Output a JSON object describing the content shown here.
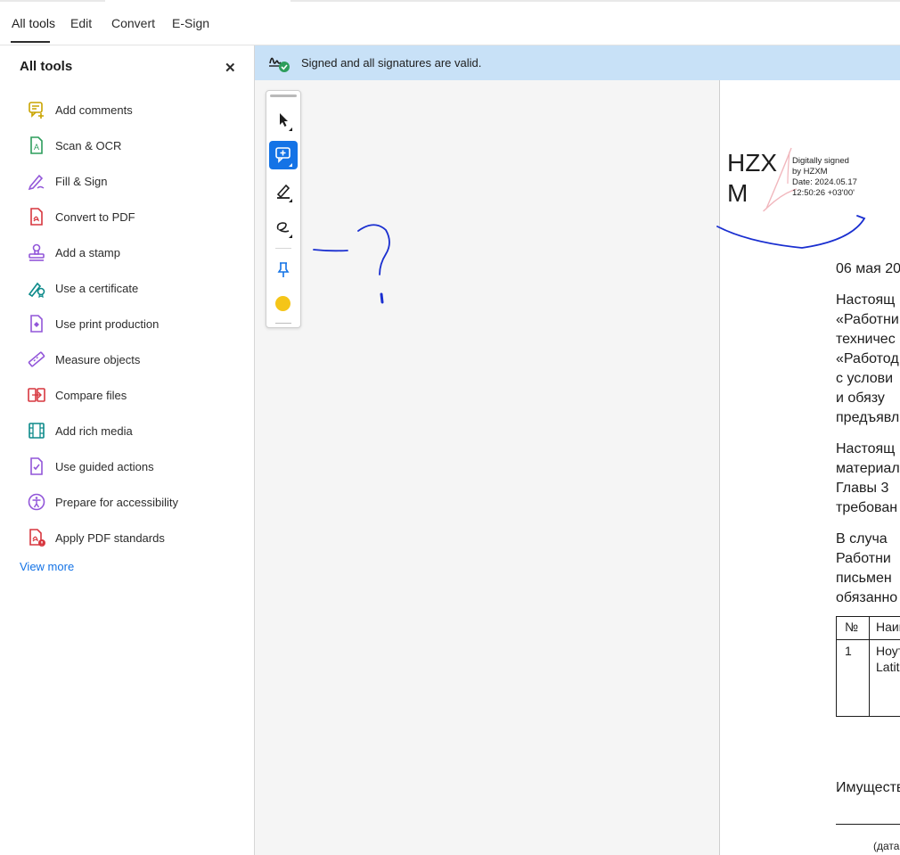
{
  "tabs": [
    {
      "label": "All tools"
    },
    {
      "label": "Edit"
    },
    {
      "label": "Convert"
    },
    {
      "label": "E-Sign"
    }
  ],
  "panel": {
    "title": "All tools",
    "close_glyph": "✕",
    "items": [
      {
        "label": "Add comments",
        "icon": "add-comments-icon",
        "color": "#c9a400"
      },
      {
        "label": "Scan & OCR",
        "icon": "scan-ocr-icon",
        "color": "#2d9d5c"
      },
      {
        "label": "Fill & Sign",
        "icon": "fill-sign-icon",
        "color": "#9256d9"
      },
      {
        "label": "Convert to PDF",
        "icon": "convert-pdf-icon",
        "color": "#d7373f"
      },
      {
        "label": "Add a stamp",
        "icon": "stamp-icon",
        "color": "#9256d9"
      },
      {
        "label": "Use a certificate",
        "icon": "certificate-icon",
        "color": "#0d8a8a"
      },
      {
        "label": "Use print production",
        "icon": "print-production-icon",
        "color": "#9256d9"
      },
      {
        "label": "Measure objects",
        "icon": "measure-icon",
        "color": "#9256d9"
      },
      {
        "label": "Compare files",
        "icon": "compare-icon",
        "color": "#d7373f"
      },
      {
        "label": "Add rich media",
        "icon": "rich-media-icon",
        "color": "#0d8a8a"
      },
      {
        "label": "Use guided actions",
        "icon": "guided-actions-icon",
        "color": "#9256d9"
      },
      {
        "label": "Prepare for accessibility",
        "icon": "accessibility-icon",
        "color": "#9256d9"
      },
      {
        "label": "Apply PDF standards",
        "icon": "pdf-standards-icon",
        "color": "#d7373f"
      }
    ],
    "view_more": "View more"
  },
  "notification": {
    "text": "Signed and all signatures are valid.",
    "icon": "signature-valid-icon"
  },
  "toolbar": {
    "tools": [
      "select-icon",
      "add-comment-icon",
      "highlight-icon",
      "draw-icon",
      "pin-icon",
      "color-picker"
    ],
    "active_color": "#1473e6",
    "ink_color": "#f5c518"
  },
  "document": {
    "signature_name_1": "HZX",
    "signature_name_2": "M",
    "signature_details": [
      "Digitally signed",
      "by HZXM",
      "Date: 2024.05.17",
      "12:50:26 +03'00'"
    ],
    "date_line": "06 мая 20",
    "paragraph_1": [
      "Настоящ",
      "«Работни",
      "техничес",
      "«Работод",
      "с услови",
      "и обязу",
      "предъявл"
    ],
    "paragraph_2": [
      "Настоящ",
      "материал",
      "Главы 3",
      "требован"
    ],
    "paragraph_3": [
      "В случа",
      "Работни",
      "письмен",
      "обязанно"
    ],
    "table": {
      "header": [
        "№",
        "Наим"
      ],
      "row_1": [
        "1",
        "Ноут"
      ],
      "row_1_extra": "Latit"
    },
    "footer_line": "Имуществ",
    "caption": "(дата"
  },
  "ink_color": "#1a2fd0"
}
